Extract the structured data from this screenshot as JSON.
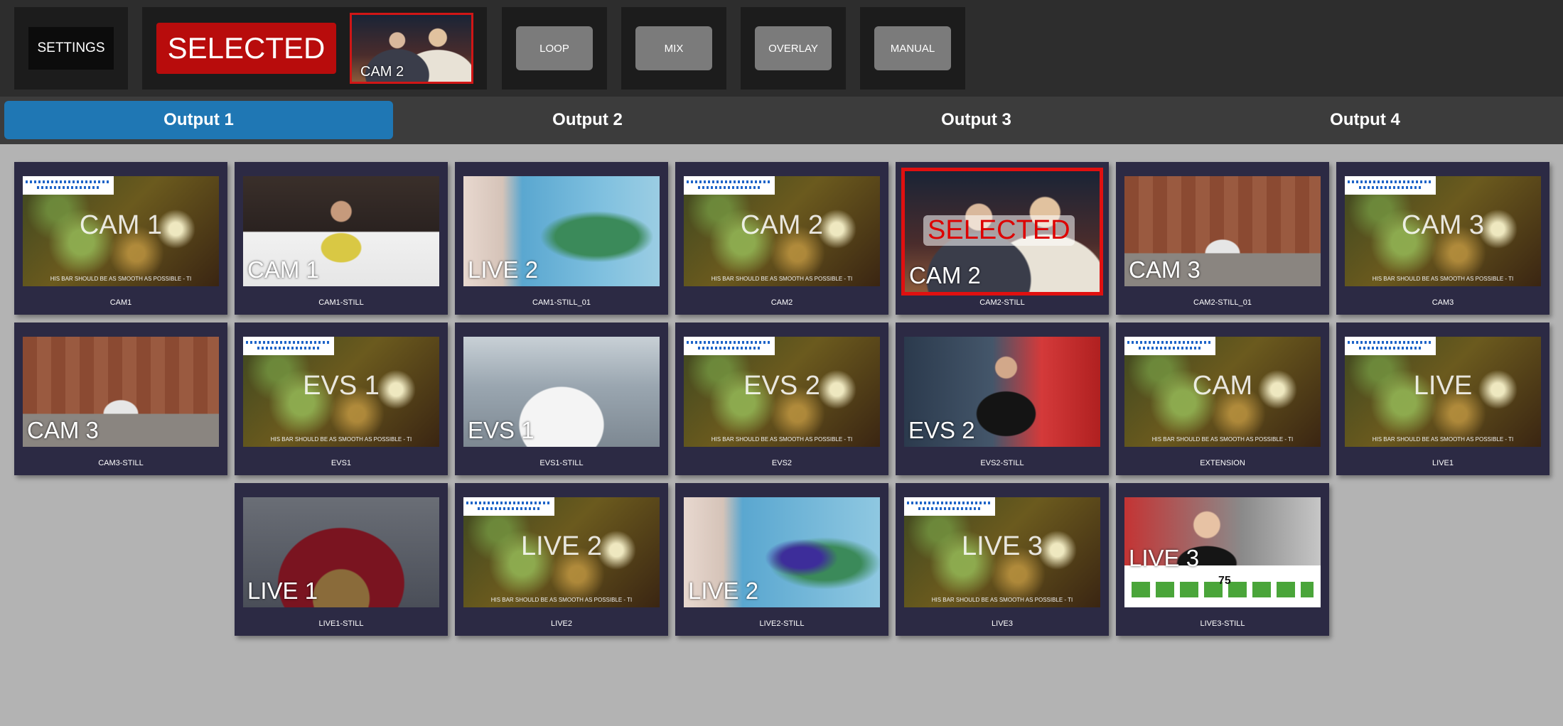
{
  "toolbar": {
    "settings_label": "SETTINGS",
    "selected_label": "SELECTED",
    "preview_caption": "CAM 2",
    "mode_buttons": [
      "LOOP",
      "MIX",
      "OVERLAY",
      "MANUAL"
    ]
  },
  "outputs": [
    "Output 1",
    "Output 2",
    "Output 3",
    "Output 4"
  ],
  "active_output": "Output 1",
  "sources": [
    {
      "name": "CAM1",
      "overlay": "CAM 1",
      "style": "bokeh",
      "selected": false
    },
    {
      "name": "CAM1-STILL",
      "overlay": "CAM 1",
      "style": "studio",
      "selected": false
    },
    {
      "name": "CAM1-STILL_01",
      "overlay": "LIVE 2",
      "style": "weather",
      "selected": false
    },
    {
      "name": "CAM2",
      "overlay": "CAM 2",
      "style": "bokeh",
      "selected": false
    },
    {
      "name": "CAM2-STILL",
      "overlay": "CAM 2",
      "style": "hosts",
      "selected": true
    },
    {
      "name": "CAM2-STILL_01",
      "overlay": "CAM 3",
      "style": "building",
      "selected": false
    },
    {
      "name": "CAM3",
      "overlay": "CAM 3",
      "style": "bokeh",
      "selected": false
    },
    {
      "name": "CAM3-STILL",
      "overlay": "CAM 3",
      "style": "building",
      "selected": false
    },
    {
      "name": "EVS1",
      "overlay": "EVS 1",
      "style": "bokeh",
      "selected": false
    },
    {
      "name": "EVS1-STILL",
      "overlay": "EVS 1",
      "style": "newsroom",
      "selected": false
    },
    {
      "name": "EVS2",
      "overlay": "EVS 2",
      "style": "bokeh",
      "selected": false
    },
    {
      "name": "EVS2-STILL",
      "overlay": "EVS 2",
      "style": "anchor",
      "selected": false
    },
    {
      "name": "EXTENSION",
      "overlay": "CAM",
      "style": "bokeh",
      "selected": false
    },
    {
      "name": "LIVE1",
      "overlay": "LIVE",
      "style": "bokeh",
      "selected": false
    },
    {
      "name": "LIVE1-STILL",
      "overlay": "LIVE 1",
      "style": "sofa",
      "selected": false
    },
    {
      "name": "LIVE2",
      "overlay": "LIVE 2",
      "style": "bokeh",
      "selected": false
    },
    {
      "name": "LIVE2-STILL",
      "overlay": "LIVE 2",
      "style": "weather2",
      "selected": false
    },
    {
      "name": "LIVE3",
      "overlay": "LIVE 3",
      "style": "bokeh",
      "selected": false
    },
    {
      "name": "LIVE3-STILL",
      "overlay": "LIVE 3",
      "style": "news3",
      "selected": false
    }
  ],
  "selected_stamp": "SELECTED",
  "ticker_text": "HIS BAR SHOULD BE AS SMOOTH AS POSSIBLE - TI",
  "news3_figure": "75"
}
